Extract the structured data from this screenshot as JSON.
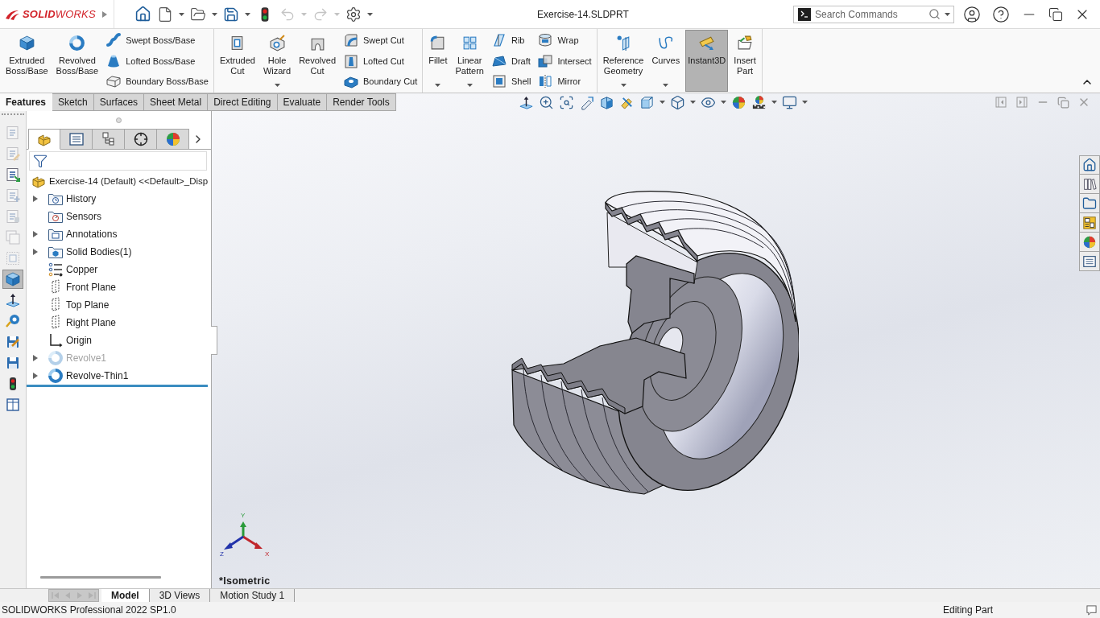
{
  "title_bar": {
    "logo": "**SOLID**WORKS",
    "document_title": "Exercise-14.SLDPRT",
    "search": {
      "placeholder": "Search Commands"
    },
    "undo": {
      "disabled": true
    },
    "redo": {
      "disabled": true
    }
  },
  "ribbon": {
    "groups": [
      {
        "items": [
          {
            "kind": "large",
            "label": "Extruded Boss/Base",
            "has_menu": false,
            "active": false
          },
          {
            "kind": "large",
            "label": "Revolved Boss/Base",
            "has_menu": false,
            "active": false
          },
          {
            "kind": "stack",
            "commands": [
              {
                "label": "Swept Boss/Base"
              },
              {
                "label": "Lofted Boss/Base"
              },
              {
                "label": "Boundary Boss/Base"
              }
            ]
          }
        ]
      },
      {
        "items": [
          {
            "kind": "large",
            "label": "Extruded Cut",
            "has_menu": false,
            "active": false
          },
          {
            "kind": "large",
            "label": "Hole Wizard",
            "has_menu": true,
            "active": false
          },
          {
            "kind": "large",
            "label": "Revolved Cut",
            "has_menu": false,
            "active": false
          },
          {
            "kind": "stack",
            "commands": [
              {
                "label": "Swept Cut"
              },
              {
                "label": "Lofted Cut"
              },
              {
                "label": "Boundary Cut"
              }
            ]
          }
        ]
      },
      {
        "items": [
          {
            "kind": "large",
            "label": "Fillet",
            "has_menu": true,
            "active": false
          },
          {
            "kind": "large",
            "label": "Linear Pattern",
            "has_menu": true,
            "active": false
          },
          {
            "kind": "stack",
            "commands": [
              {
                "label": "Rib"
              },
              {
                "label": "Draft"
              },
              {
                "label": "Shell"
              }
            ]
          },
          {
            "kind": "stack",
            "commands": [
              {
                "label": "Wrap"
              },
              {
                "label": "Intersect"
              },
              {
                "label": "Mirror"
              }
            ]
          }
        ]
      },
      {
        "items": [
          {
            "kind": "large",
            "label": "Reference Geometry",
            "has_menu": true,
            "active": false
          },
          {
            "kind": "large",
            "label": "Curves",
            "has_menu": true,
            "active": false
          },
          {
            "kind": "large",
            "label": "Instant3D",
            "has_menu": false,
            "active": true
          },
          {
            "kind": "large",
            "label": "Insert Part",
            "has_menu": false,
            "active": false
          }
        ]
      }
    ]
  },
  "command_tabs": [
    {
      "label": "Features",
      "selected": true
    },
    {
      "label": "Sketch",
      "selected": false
    },
    {
      "label": "Surfaces",
      "selected": false
    },
    {
      "label": "Sheet Metal",
      "selected": false
    },
    {
      "label": "Direct Editing",
      "selected": false
    },
    {
      "label": "Evaluate",
      "selected": false
    },
    {
      "label": "Render Tools",
      "selected": false
    }
  ],
  "left_toolbar": [
    {
      "disabled": true,
      "selected": false
    },
    {
      "disabled": true,
      "selected": false
    },
    {
      "disabled": false,
      "selected": false
    },
    {
      "disabled": true,
      "selected": false
    },
    {
      "disabled": true,
      "selected": false
    },
    {
      "disabled": true,
      "selected": false
    },
    {
      "disabled": true,
      "selected": false
    },
    {
      "disabled": false,
      "selected": true
    },
    {
      "disabled": false,
      "selected": false
    },
    {
      "disabled": false,
      "selected": false
    },
    {
      "disabled": false,
      "selected": false
    },
    {
      "disabled": false,
      "selected": false
    },
    {
      "disabled": false,
      "selected": false
    },
    {
      "disabled": false,
      "selected": false
    }
  ],
  "feature_manager": {
    "tabs": [
      {
        "selected": true
      },
      {
        "selected": false
      },
      {
        "selected": false
      },
      {
        "selected": false
      },
      {
        "selected": false
      }
    ],
    "tree": {
      "label": "Exercise-14 (Default) <<Default>_Disp",
      "children": [
        {
          "label": "History",
          "expandable": true,
          "suppressed": false
        },
        {
          "label": "Sensors",
          "expandable": false,
          "suppressed": false
        },
        {
          "label": "Annotations",
          "expandable": true,
          "suppressed": false
        },
        {
          "label": "Solid Bodies(1)",
          "expandable": true,
          "suppressed": false
        },
        {
          "label": "Copper",
          "expandable": false,
          "suppressed": false
        },
        {
          "label": "Front Plane",
          "expandable": false,
          "suppressed": false
        },
        {
          "label": "Top Plane",
          "expandable": false,
          "suppressed": false
        },
        {
          "label": "Right Plane",
          "expandable": false,
          "suppressed": false
        },
        {
          "label": "Origin",
          "expandable": false,
          "suppressed": false
        },
        {
          "label": "Revolve1",
          "expandable": true,
          "suppressed": true
        },
        {
          "label": "Revolve-Thin1",
          "expandable": true,
          "suppressed": false
        }
      ]
    }
  },
  "graphics": {
    "view_name": "*Isometric",
    "triad": {
      "y_label": "Y",
      "z_label": "Z",
      "x_label": "X"
    }
  },
  "bottom_tabs": {
    "navigation_disabled": true,
    "tabs": [
      {
        "label": "Model",
        "selected": true
      },
      {
        "label": "3D Views",
        "selected": false
      },
      {
        "label": "Motion Study 1",
        "selected": false
      }
    ]
  },
  "status_bar": {
    "product": "SOLIDWORKS Professional 2022 SP1.0",
    "mode": "Editing Part"
  }
}
